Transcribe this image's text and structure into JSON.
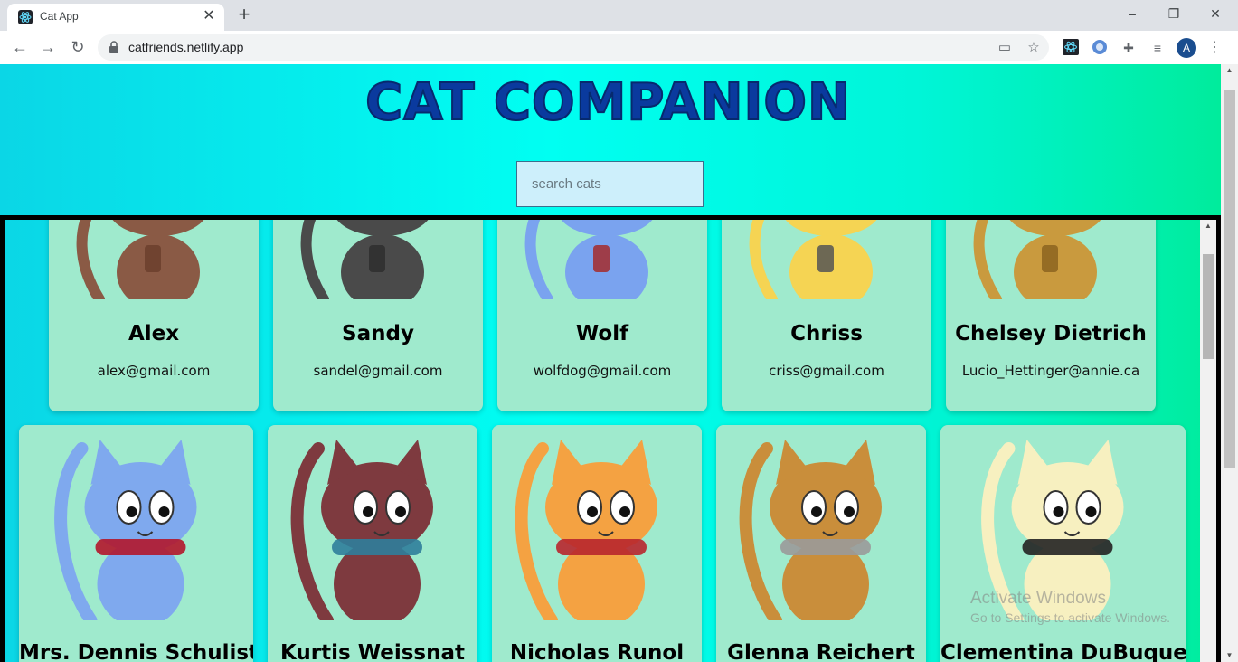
{
  "browser": {
    "tab_title": "Cat App",
    "tab_close_label": "✕",
    "new_tab_label": "+",
    "url": "catfriends.netlify.app",
    "avatar_letter": "A",
    "window_buttons": [
      "–",
      "❐",
      "✕"
    ],
    "icons": [
      "back-arrow-icon",
      "forward-arrow-icon",
      "reload-icon",
      "lock-icon",
      "cast-icon",
      "star-icon",
      "react-devtools-icon",
      "extension-icon",
      "puzzle-icon",
      "media-icon",
      "kebab-menu-icon"
    ]
  },
  "page": {
    "title": "CAT COMPANION",
    "search_placeholder": "search cats",
    "colors": {
      "bg_start": "#0bd6e6",
      "bg_mid": "#00fff2",
      "bg_end": "#00ec9c",
      "card": "#9feacd",
      "title": "#0a3a9e"
    }
  },
  "cats": [
    {
      "name": "Alex",
      "email": "alex@gmail.com",
      "fur": "#8a5a45",
      "accent": "#6b3f2d"
    },
    {
      "name": "Sandy",
      "email": "sandel@gmail.com",
      "fur": "#4a4a4a",
      "accent": "#2e2e2e"
    },
    {
      "name": "Wolf",
      "email": "wolfdog@gmail.com",
      "fur": "#7aa3ef",
      "accent": "#a52b2b"
    },
    {
      "name": "Chriss",
      "email": "criss@gmail.com",
      "fur": "#f5d453",
      "accent": "#555555"
    },
    {
      "name": "Chelsey Dietrich",
      "email": "Lucio_Hettinger@annie.ca",
      "fur": "#c99a3e",
      "accent": "#8c6420"
    },
    {
      "name": "Mrs. Dennis Schulist",
      "fur": "#7fa9ee",
      "accent": "#b3162b"
    },
    {
      "name": "Kurtis Weissnat",
      "fur": "#7e3a3f",
      "accent": "#2f7e9b"
    },
    {
      "name": "Nicholas Runol",
      "fur": "#f4a242",
      "accent": "#b8262e"
    },
    {
      "name": "Glenna Reichert",
      "fur": "#c98e3b",
      "accent": "#9a9a9a"
    },
    {
      "name": "Clementina DuBuque",
      "fur": "#f7f0c0",
      "accent": "#222222"
    }
  ],
  "os_watermark": {
    "line1": "Activate Windows",
    "line2": "Go to Settings to activate Windows."
  }
}
